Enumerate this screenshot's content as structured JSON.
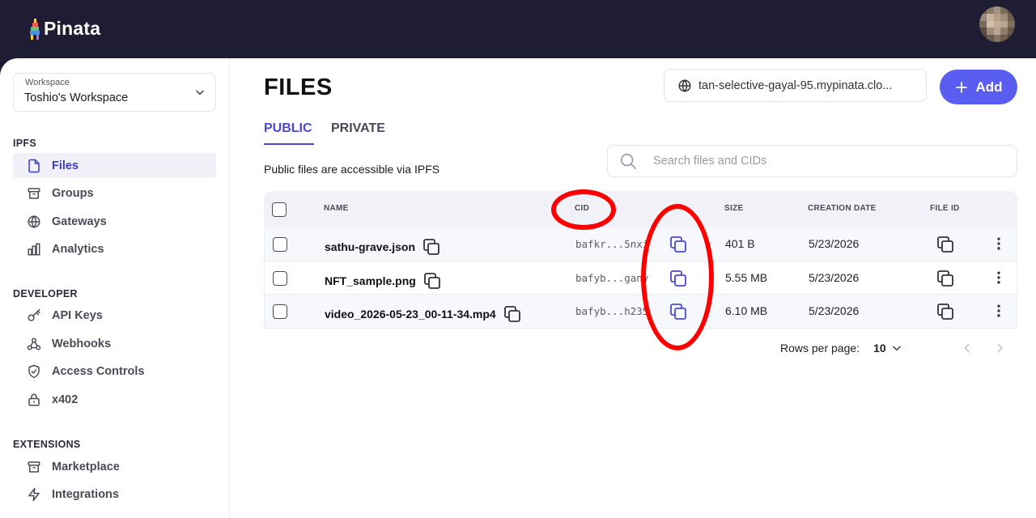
{
  "app": {
    "name": "Pinata"
  },
  "sidebar": {
    "workspace_label": "Workspace",
    "workspace_value": "Toshio's Workspace",
    "sections": [
      {
        "title": "IPFS",
        "items": [
          {
            "label": "Files",
            "icon": "file-icon",
            "active": true
          },
          {
            "label": "Groups",
            "icon": "archive-icon"
          },
          {
            "label": "Gateways",
            "icon": "globe-icon"
          },
          {
            "label": "Analytics",
            "icon": "bar-chart-icon"
          }
        ]
      },
      {
        "title": "DEVELOPER",
        "items": [
          {
            "label": "API Keys",
            "icon": "key-icon"
          },
          {
            "label": "Webhooks",
            "icon": "webhook-icon"
          },
          {
            "label": "Access Controls",
            "icon": "shield-icon"
          },
          {
            "label": "x402",
            "icon": "lock-icon"
          }
        ]
      },
      {
        "title": "EXTENSIONS",
        "items": [
          {
            "label": "Marketplace",
            "icon": "archive-icon"
          },
          {
            "label": "Integrations",
            "icon": "bolt-icon"
          }
        ]
      }
    ]
  },
  "main": {
    "title": "FILES",
    "gateway": "tan-selective-gayal-95.mypinata.clo...",
    "add_label": "Add",
    "tabs": [
      {
        "label": "PUBLIC",
        "active": true
      },
      {
        "label": "PRIVATE"
      }
    ],
    "subtitle": "Public files are accessible via IPFS",
    "search_placeholder": "Search files and CIDs",
    "table": {
      "columns": {
        "name": "NAME",
        "cid": "CID",
        "size": "SIZE",
        "date": "CREATION DATE",
        "file_id": "FILE ID"
      },
      "rows": [
        {
          "name": "sathu-grave.json",
          "cid": "bafkr...5nxi",
          "size": "401 B",
          "date": "5/23/2026"
        },
        {
          "name": "NFT_sample.png",
          "cid": "bafyb...gany",
          "size": "5.55 MB",
          "date": "5/23/2026"
        },
        {
          "name": "video_2026-05-23_00-11-34.mp4",
          "cid": "bafyb...h235",
          "size": "6.10 MB",
          "date": "5/23/2026"
        }
      ]
    },
    "pagination": {
      "label": "Rows per page:",
      "value": "10"
    }
  },
  "colors": {
    "accent": "#5a5ef0",
    "sidebar_active": "#3b3ac4",
    "topbar": "#1f1d33",
    "annotation": "#ff0000"
  }
}
